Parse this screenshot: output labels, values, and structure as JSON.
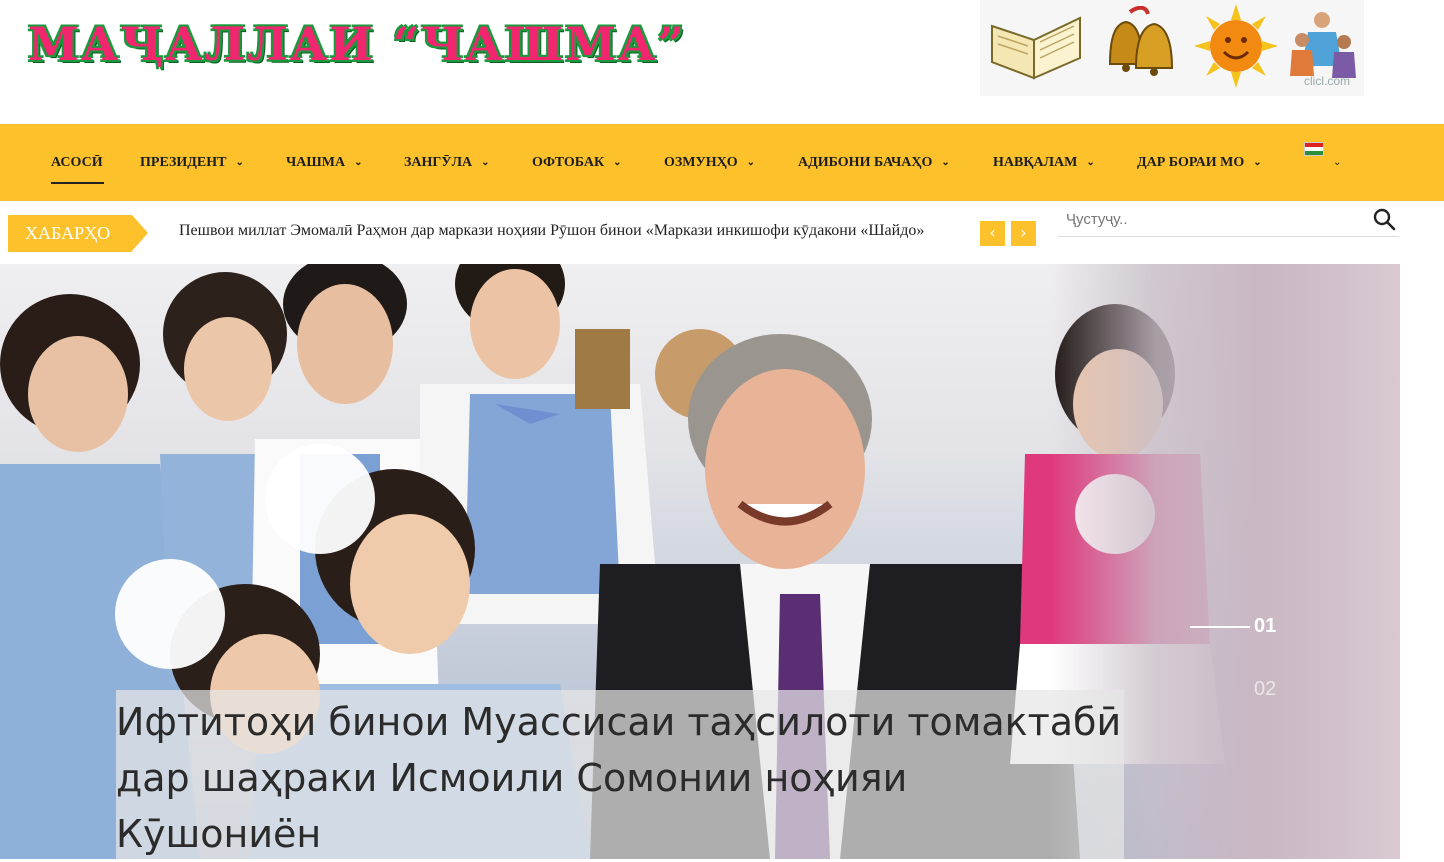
{
  "header": {
    "logo_text": "МАҶАЛЛАИ “ЧАШМА”",
    "banner_watermark": "clicl.com",
    "banner_icons": [
      "book-icon",
      "bells-icon",
      "sun-icon",
      "children-icon"
    ]
  },
  "nav": {
    "items": [
      {
        "label": "АСОСӢ",
        "has_dropdown": false,
        "active": true
      },
      {
        "label": "ПРЕЗИДЕНТ",
        "has_dropdown": true
      },
      {
        "label": "ЧАШМА",
        "has_dropdown": true
      },
      {
        "label": "ЗАНГӮЛА",
        "has_dropdown": true
      },
      {
        "label": "ОФТОБАК",
        "has_dropdown": true
      },
      {
        "label": "ОЗМУНҲО",
        "has_dropdown": true
      },
      {
        "label": "АДИБОНИ БАЧАҲО",
        "has_dropdown": true
      },
      {
        "label": "НАВҚАЛАМ",
        "has_dropdown": true
      },
      {
        "label": "ДАР БОРАИ МО",
        "has_dropdown": true
      }
    ],
    "chevron": "⌄",
    "colors": {
      "bar": "#fcc12b",
      "text": "#1d1d1d"
    }
  },
  "ticker": {
    "label": "ХАБАРҲО",
    "text": "Пешвои миллат Эмомалӣ Раҳмон дар маркази ноҳияи Рӯшон бинои «Маркази инкишофи кӯдакони «Шайдо»",
    "prev_symbol": "‹",
    "next_symbol": "›"
  },
  "search": {
    "placeholder": "Ҷустуҷу.."
  },
  "slider": {
    "title": "Ифтитоҳи бинои Муассисаи таҳсилоти томактабӣ дар шаҳраки Исмоили Сомонии ноҳияи Кӯшониён",
    "slides": [
      "01",
      "02"
    ],
    "active_slide": "01"
  }
}
